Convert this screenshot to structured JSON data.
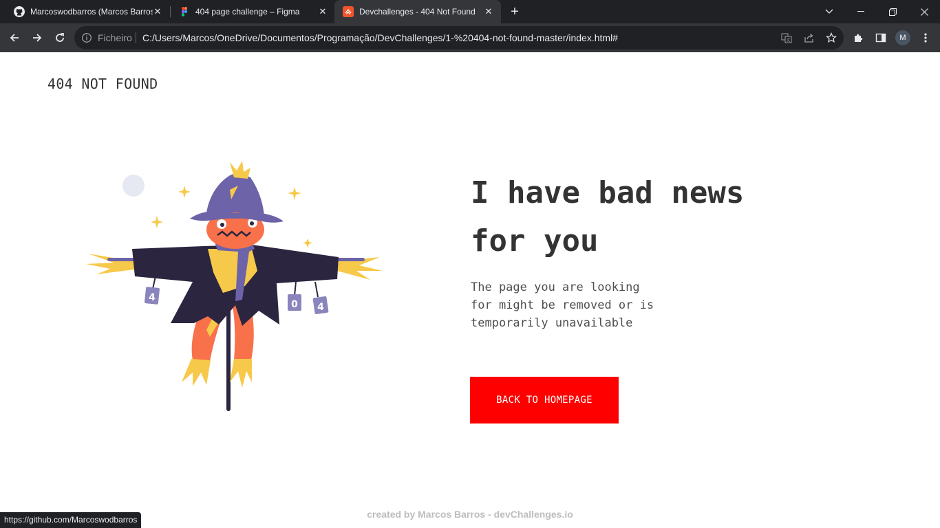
{
  "browser": {
    "tabs": [
      {
        "title": "Marcoswodbarros (Marcos Barros)",
        "favicon": "github-icon"
      },
      {
        "title": "404 page challenge – Figma",
        "favicon": "figma-icon"
      },
      {
        "title": "Devchallenges - 404 Not Found",
        "favicon": "devchallenges-icon",
        "active": true
      }
    ],
    "new_tab_symbol": "+",
    "close_symbol": "✕",
    "scheme_label": "Ficheiro",
    "url": "C:/Users/Marcos/OneDrive/Documentos/Programação/DevChallenges/1-%20404-not-found-master/index.html#",
    "profile_initial": "M",
    "status_url": "https://github.com/Marcoswodbarros"
  },
  "page": {
    "brand": "404 NOT FOUND",
    "headline_line1": "I have bad news",
    "headline_line2": "for you",
    "subtext_line1": "The page you are looking",
    "subtext_line2": "for might be removed or is",
    "subtext_line3": "temporarily unavailable",
    "cta_label": "BACK TO HOMEPAGE",
    "footer": "created by Marcos Barros - devChallenges.io",
    "can_left": "4",
    "can_middle": "0",
    "can_right": "4"
  },
  "colors": {
    "accent": "#ff0000",
    "heading": "#333333",
    "body_text": "#4f4f4f",
    "footer_text": "#bdbdbd"
  }
}
